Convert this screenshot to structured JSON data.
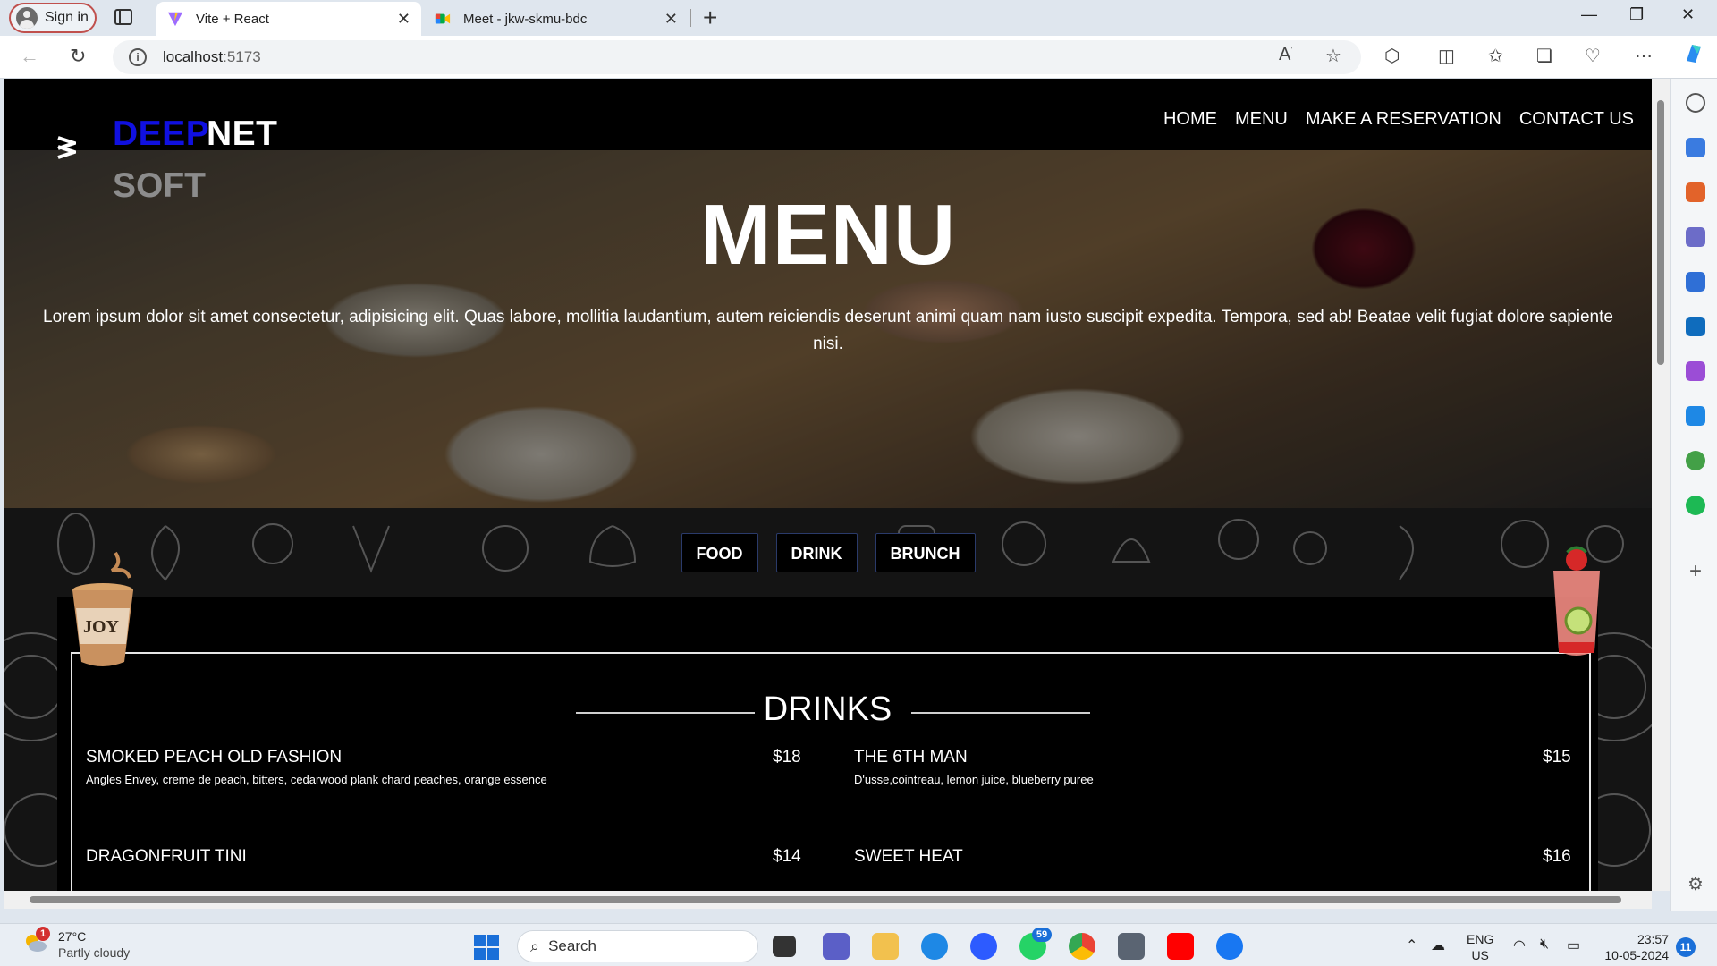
{
  "browser": {
    "signin_label": "Sign in",
    "tabs": [
      {
        "title": "Vite + React",
        "close": "✕"
      },
      {
        "title": "Meet - jkw-skmu-bdc",
        "close": "✕"
      }
    ],
    "new_tab": "+",
    "url_host": "localhost",
    "url_port": ":5173",
    "window_controls": [
      "—",
      "❐",
      "✕"
    ]
  },
  "site": {
    "logo": {
      "word1": "DEEP",
      "word2": "NET",
      "word3": "SOFT"
    },
    "nav": [
      "HOME",
      "MENU",
      "MAKE A RESERVATION",
      "CONTACT US"
    ],
    "hero_title": "MENU",
    "hero_description": "Lorem ipsum dolor sit amet consectetur, adipisicing elit. Quas labore, mollitia laudantium, autem reiciendis deserunt animi quam nam iusto suscipit expedita. Tempora, sed ab! Beatae velit fugiat dolore sapiente nisi.",
    "categories": [
      "FOOD",
      "DRINK",
      "BRUNCH"
    ],
    "section_title": "DRINKS",
    "cup_brand": "JOY",
    "items": [
      {
        "name": "SMOKED PEACH OLD FASHION",
        "price": "$18",
        "description": "Angles Envey, creme de peach, bitters, cedarwood plank chard peaches, orange essence"
      },
      {
        "name": "THE 6TH MAN",
        "price": "$15",
        "description": "D'usse,cointreau, lemon juice, blueberry puree"
      },
      {
        "name": "DRAGONFRUIT TINI",
        "price": "$14",
        "description": ""
      },
      {
        "name": "SWEET HEAT",
        "price": "$16",
        "description": ""
      }
    ]
  },
  "taskbar": {
    "weather_badge": "1",
    "temperature": "27°C",
    "condition": "Partly cloudy",
    "search_placeholder": "Search",
    "whatsapp_badge": "59",
    "language": "ENG",
    "region": "US",
    "time": "23:57",
    "date": "10-05-2024",
    "notifications": "11"
  }
}
